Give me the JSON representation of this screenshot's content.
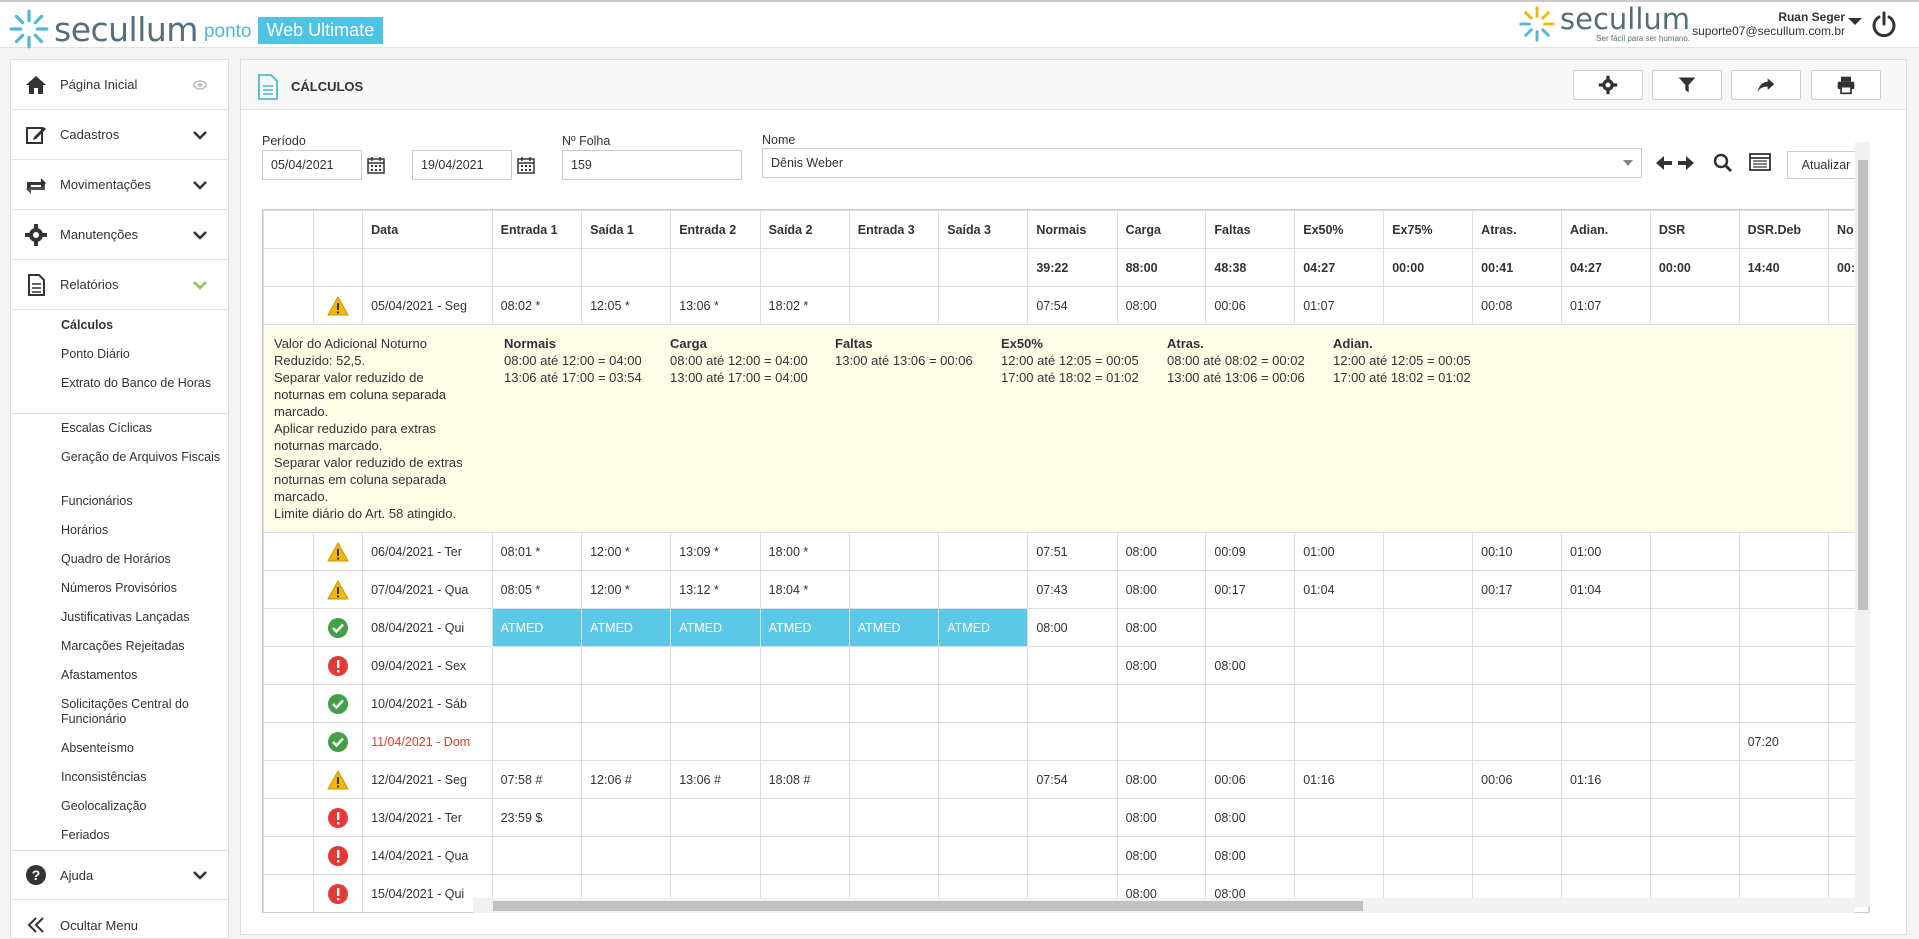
{
  "header": {
    "logo_text": "secullum",
    "logo_ponto": "ponto",
    "logo_web": "Web Ultimate",
    "brand_right_name": "secullum",
    "brand_right_slogan": "Ser fácil para ser humano.",
    "user_name": "Ruan Seger",
    "user_email": "suporte07@secullum.com.br",
    "brand_color": "#4fc3e4"
  },
  "sidebar": {
    "menu": [
      {
        "label": "Página Inicial",
        "icon": "home-icon"
      },
      {
        "label": "Cadastros",
        "icon": "edit-icon"
      },
      {
        "label": "Movimentações",
        "icon": "exchange-icon"
      },
      {
        "label": "Manutenções",
        "icon": "gear-icon"
      },
      {
        "label": "Relatórios",
        "icon": "document-icon"
      }
    ],
    "reports_group1": [
      "Cálculos",
      "Ponto Diário",
      "Extrato do Banco de Horas"
    ],
    "reports_group2": [
      "Escalas Cíclicas",
      "Geração de Arquivos Fiscais",
      "Funcionários",
      "Horários",
      "Quadro de Horários",
      "Números Provisórios",
      "Justificativas Lançadas",
      "Marcações Rejeitadas",
      "Afastamentos",
      "Solicitações Central do Funcionário",
      "Absenteísmo",
      "Inconsistências",
      "Geolocalização",
      "Feriados"
    ],
    "help_label": "Ajuda",
    "hide_menu_label": "Ocultar Menu"
  },
  "main": {
    "title": "CÁLCULOS",
    "filters": {
      "period_label": "Período",
      "date_start": "05/04/2021",
      "date_end": "19/04/2021",
      "folha_label": "Nº Folha",
      "folha_value": "159",
      "name_label": "Nome",
      "name_value": "Dênis Weber",
      "refresh_label": "Atualizar"
    },
    "columns": [
      "Data",
      "Entrada 1",
      "Saída 1",
      "Entrada 2",
      "Saída 2",
      "Entrada 3",
      "Saída 3",
      "Normais",
      "Carga",
      "Faltas",
      "Ex50%",
      "Ex75%",
      "Atras.",
      "Adian.",
      "DSR",
      "DSR.Deb",
      "No"
    ],
    "totals": [
      "",
      "",
      "",
      "",
      "",
      "",
      "",
      "39:22",
      "88:00",
      "48:38",
      "04:27",
      "00:00",
      "00:41",
      "04:27",
      "00:00",
      "14:40",
      "00:"
    ],
    "rows": [
      {
        "status": "warning",
        "date": "05/04/2021 - Seg",
        "cells": [
          "08:02 *",
          "12:05 *",
          "13:06 *",
          "18:02 *",
          "",
          "",
          "07:54",
          "08:00",
          "00:06",
          "01:07",
          "",
          "00:08",
          "01:07",
          "",
          "",
          ""
        ]
      },
      {
        "status": "warning",
        "date": "06/04/2021 - Ter",
        "cells": [
          "08:01 *",
          "12:00 *",
          "13:09 *",
          "18:00 *",
          "",
          "",
          "07:51",
          "08:00",
          "00:09",
          "01:00",
          "",
          "00:10",
          "01:00",
          "",
          "",
          ""
        ]
      },
      {
        "status": "warning",
        "date": "07/04/2021 - Qua",
        "cells": [
          "08:05 *",
          "12:00 *",
          "13:12 *",
          "18:04 *",
          "",
          "",
          "07:43",
          "08:00",
          "00:17",
          "01:04",
          "",
          "00:17",
          "01:04",
          "",
          "",
          ""
        ]
      },
      {
        "status": "ok",
        "date": "08/04/2021 - Qui",
        "atmed": true,
        "cells": [
          "ATMED",
          "ATMED",
          "ATMED",
          "ATMED",
          "ATMED",
          "ATMED",
          "08:00",
          "08:00",
          "",
          "",
          "",
          "",
          "",
          "",
          "",
          ""
        ]
      },
      {
        "status": "error",
        "date": "09/04/2021 - Sex",
        "cells": [
          "",
          "",
          "",
          "",
          "",
          "",
          "",
          "08:00",
          "08:00",
          "",
          "",
          "",
          "",
          "",
          "",
          ""
        ]
      },
      {
        "status": "ok",
        "date": "10/04/2021 - Sáb",
        "cells": [
          "",
          "",
          "",
          "",
          "",
          "",
          "",
          "",
          "",
          "",
          "",
          "",
          "",
          "",
          "",
          ""
        ]
      },
      {
        "status": "ok",
        "date": "11/04/2021 - Dom",
        "sunday": true,
        "cells": [
          "",
          "",
          "",
          "",
          "",
          "",
          "",
          "",
          "",
          "",
          "",
          "",
          "",
          "",
          "07:20",
          ""
        ]
      },
      {
        "status": "warning",
        "date": "12/04/2021 - Seg",
        "cells": [
          "07:58 #",
          "12:06 #",
          "13:06 #",
          "18:08 #",
          "",
          "",
          "07:54",
          "08:00",
          "00:06",
          "01:16",
          "",
          "00:06",
          "01:16",
          "",
          "",
          ""
        ]
      },
      {
        "status": "error",
        "date": "13/04/2021 - Ter",
        "cells": [
          "23:59 $",
          "",
          "",
          "",
          "",
          "",
          "",
          "08:00",
          "08:00",
          "",
          "",
          "",
          "",
          "",
          "",
          ""
        ]
      },
      {
        "status": "error",
        "date": "14/04/2021 - Qua",
        "cells": [
          "",
          "",
          "",
          "",
          "",
          "",
          "",
          "08:00",
          "08:00",
          "",
          "",
          "",
          "",
          "",
          "",
          ""
        ]
      },
      {
        "status": "error",
        "date": "15/04/2021 - Qui",
        "cells": [
          "",
          "",
          "",
          "",
          "",
          "",
          "",
          "08:00",
          "08:00",
          "",
          "",
          "",
          "",
          "",
          "",
          ""
        ]
      }
    ],
    "detail": {
      "left_lines": [
        "Valor do Adicional Noturno Reduzido: 52,5.",
        "Separar valor reduzido de noturnas em coluna separada marcado.",
        "Aplicar reduzido para extras noturnas marcado.",
        "Separar valor reduzido de extras noturnas em coluna separada marcado.",
        "Limite diário do Art. 58 atingido."
      ],
      "groups": [
        {
          "title": "Normais",
          "lines": [
            "08:00 até 12:00 = 04:00",
            "13:06 até 17:00 = 03:54"
          ]
        },
        {
          "title": "Carga",
          "lines": [
            "08:00 até 12:00 = 04:00",
            "13:00 até 17:00 = 04:00"
          ]
        },
        {
          "title": "Faltas",
          "lines": [
            "13:00 até 13:06 = 00:06"
          ]
        },
        {
          "title": "Ex50%",
          "lines": [
            "12:00 até 12:05 = 00:05",
            "17:00 até 18:02 = 01:02"
          ]
        },
        {
          "title": "Atras.",
          "lines": [
            "08:00 até 08:02 = 00:02",
            "13:00 até 13:06 = 00:06"
          ]
        },
        {
          "title": "Adian.",
          "lines": [
            "12:00 até 12:05 = 00:05",
            "17:00 até 18:02 = 01:02"
          ]
        }
      ]
    }
  }
}
